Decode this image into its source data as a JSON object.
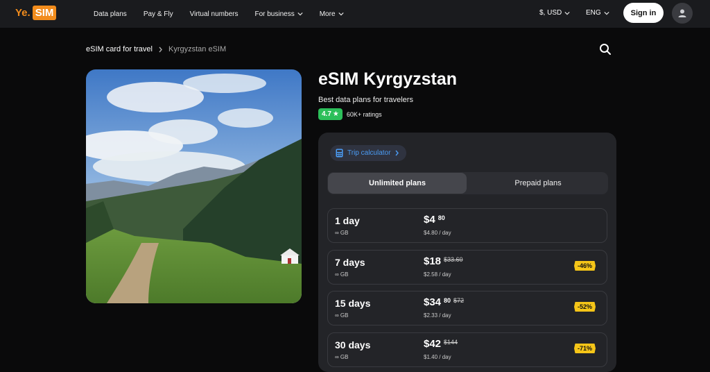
{
  "logo": {
    "ye": "Ye.",
    "sim": "SIM"
  },
  "nav": {
    "items": [
      {
        "label": "Data plans"
      },
      {
        "label": "Pay & Fly"
      },
      {
        "label": "Virtual numbers"
      },
      {
        "label": "For business"
      },
      {
        "label": "More"
      }
    ],
    "currency": "$, USD",
    "language": "ENG",
    "signin": "Sign in"
  },
  "breadcrumb": {
    "first": "eSIM card for travel",
    "second": "Kyrgyzstan eSIM"
  },
  "product": {
    "title": "eSIM Kyrgyzstan",
    "subtitle": "Best data plans for travelers",
    "rating": "4.7",
    "ratings_count": "60K+ ratings"
  },
  "panel": {
    "trip_calculator": "Trip calculator",
    "tabs": {
      "unlimited": "Unlimited plans",
      "prepaid": "Prepaid plans"
    },
    "plans": [
      {
        "days": "1 day",
        "gb": "∞ GB",
        "price": "$4",
        "cents": "80",
        "old": "",
        "perday": "$4.80 / day",
        "discount": ""
      },
      {
        "days": "7 days",
        "gb": "∞ GB",
        "price": "$18",
        "cents": "",
        "old": "$33.60",
        "perday": "$2.58 / day",
        "discount": "-46%"
      },
      {
        "days": "15 days",
        "gb": "∞ GB",
        "price": "$34",
        "cents": "80",
        "old": "$72",
        "perday": "$2.33 / day",
        "discount": "-52%"
      },
      {
        "days": "30 days",
        "gb": "∞ GB",
        "price": "$42",
        "cents": "",
        "old": "$144",
        "perday": "$1.40 / day",
        "discount": "-71%"
      }
    ]
  },
  "colors": {
    "accent": "#f28c1c",
    "rating": "#2cbf5a",
    "discount": "#f5c518",
    "link": "#4b9cf5"
  }
}
